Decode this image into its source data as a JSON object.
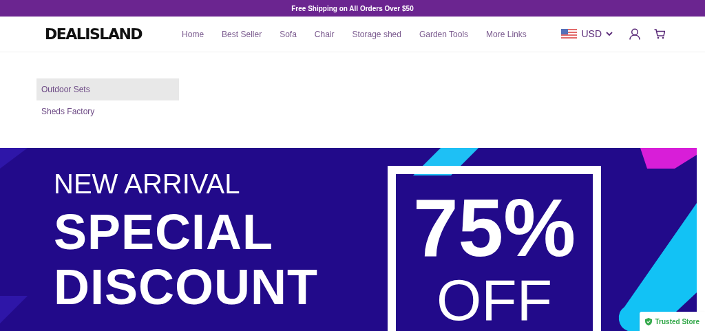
{
  "announcement": "Free Shipping on All Orders Over $50",
  "header": {
    "logo": "DEALISLAND",
    "nav": [
      {
        "label": "Home"
      },
      {
        "label": "Best Seller"
      },
      {
        "label": "Sofa"
      },
      {
        "label": "Chair"
      },
      {
        "label": "Storage shed"
      },
      {
        "label": "Garden Tools"
      },
      {
        "label": "More Links"
      }
    ],
    "currency": "USD"
  },
  "dropdown": [
    {
      "label": "Outdoor Sets",
      "selected": true
    },
    {
      "label": "Sheds Factory",
      "selected": false
    }
  ],
  "banner": {
    "line_1": "NEW ARRIVAL",
    "line_2": "SPECIAL",
    "line_3": "DISCOUNT",
    "percent": "75%",
    "off": "OFF"
  },
  "badge": "Trusted Store"
}
